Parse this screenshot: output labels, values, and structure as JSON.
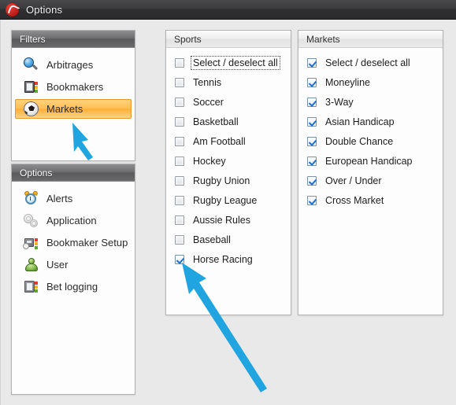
{
  "window": {
    "title": "Options",
    "app_icon": "r-logo-icon"
  },
  "sidebar": {
    "filters_panel": {
      "header": "Filters",
      "items": [
        {
          "label": "Arbitrages",
          "icon": "magnifier-icon",
          "selected": false
        },
        {
          "label": "Bookmakers",
          "icon": "book-icon",
          "selected": false
        },
        {
          "label": "Markets",
          "icon": "soccer-ball-icon",
          "selected": true
        }
      ]
    },
    "options_panel": {
      "header": "Options",
      "items": [
        {
          "label": "Alerts",
          "icon": "alarm-clock-icon",
          "selected": false
        },
        {
          "label": "Application",
          "icon": "gears-icon",
          "selected": false
        },
        {
          "label": "Bookmaker Setup",
          "icon": "bookmaker-setup-icon",
          "selected": false
        },
        {
          "label": "User",
          "icon": "user-icon",
          "selected": false
        },
        {
          "label": "Bet logging",
          "icon": "book-gray-icon",
          "selected": false
        }
      ]
    }
  },
  "sports_panel": {
    "header": "Sports",
    "items": [
      {
        "label": "Select / deselect all",
        "checked": false,
        "focused": true
      },
      {
        "label": "Tennis",
        "checked": false,
        "focused": false
      },
      {
        "label": "Soccer",
        "checked": false,
        "focused": false
      },
      {
        "label": "Basketball",
        "checked": false,
        "focused": false
      },
      {
        "label": "Am Football",
        "checked": false,
        "focused": false
      },
      {
        "label": "Hockey",
        "checked": false,
        "focused": false
      },
      {
        "label": "Rugby Union",
        "checked": false,
        "focused": false
      },
      {
        "label": "Rugby League",
        "checked": false,
        "focused": false
      },
      {
        "label": "Aussie Rules",
        "checked": false,
        "focused": false
      },
      {
        "label": "Baseball",
        "checked": false,
        "focused": false
      },
      {
        "label": "Horse Racing",
        "checked": true,
        "focused": false
      }
    ]
  },
  "markets_panel": {
    "header": "Markets",
    "items": [
      {
        "label": "Select / deselect all",
        "checked": true
      },
      {
        "label": "Moneyline",
        "checked": true
      },
      {
        "label": "3-Way",
        "checked": true
      },
      {
        "label": "Asian Handicap",
        "checked": true
      },
      {
        "label": "Double Chance",
        "checked": true
      },
      {
        "label": "European Handicap",
        "checked": true
      },
      {
        "label": "Over / Under",
        "checked": true
      },
      {
        "label": "Cross Market",
        "checked": true
      }
    ]
  },
  "annotations": {
    "arrow_color": "#21a5e1",
    "arrows": [
      {
        "name": "arrow-pointing-to-markets",
        "target": "Markets"
      },
      {
        "name": "arrow-pointing-to-horse-racing",
        "target": "Horse Racing"
      }
    ]
  },
  "colors": {
    "accent_orange": "#fcae36",
    "titlebar": "#3c3c3e",
    "arrow_blue": "#21a5e1",
    "check_blue": "#1f6fd0"
  }
}
